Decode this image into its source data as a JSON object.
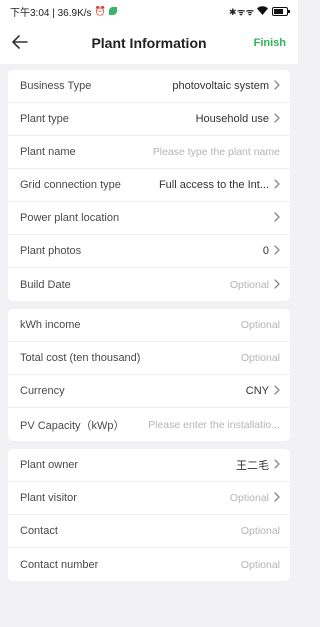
{
  "status": {
    "time_speed": "下午3:04 | 36.9K/s",
    "signal": "✱ ᯤ ᯤ",
    "wifi_icon": "wifi-icon",
    "battery_icon": "battery-icon"
  },
  "nav": {
    "title": "Plant Information",
    "finish": "Finish"
  },
  "section1": [
    {
      "label": "Business Type",
      "value": "photovoltaic system",
      "chevron": true
    },
    {
      "label": "Plant type",
      "value": "Household use",
      "chevron": true
    },
    {
      "label": "Plant name",
      "value": "Please type the plant name",
      "placeholder": true
    },
    {
      "label": "Grid connection type",
      "value": "Full access to the Int...",
      "chevron": true
    },
    {
      "label": "Power plant location",
      "value": "",
      "chevron": true
    },
    {
      "label": "Plant photos",
      "value": "0",
      "chevron": true
    },
    {
      "label": "Build Date",
      "value": "Optional",
      "placeholder": true,
      "chevron": true
    }
  ],
  "section2": [
    {
      "label": "kWh income",
      "value": "Optional",
      "placeholder": true
    },
    {
      "label": "Total cost (ten thousand)",
      "value": "Optional",
      "placeholder": true
    },
    {
      "label": "Currency",
      "value": "CNY",
      "chevron": true
    },
    {
      "label": "PV Capacity（kWp）",
      "value": "Please enter the installatio...",
      "placeholder": true
    }
  ],
  "section3": [
    {
      "label": "Plant owner",
      "value": "王二毛",
      "chevron": true
    },
    {
      "label": "Plant visitor",
      "value": "Optional",
      "placeholder": true,
      "chevron": true
    },
    {
      "label": "Contact",
      "value": "Optional",
      "placeholder": true
    },
    {
      "label": "Contact number",
      "value": "Optional",
      "placeholder": true
    }
  ],
  "colors": {
    "accent": "#2fb35a",
    "background": "#f2f2f4"
  }
}
